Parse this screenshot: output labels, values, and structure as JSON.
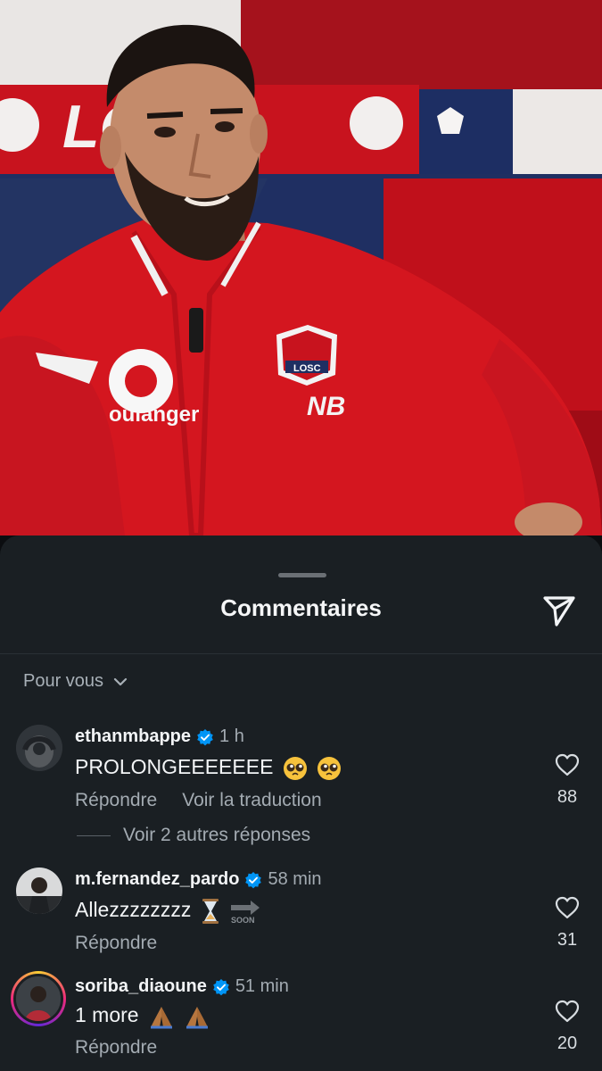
{
  "sheet": {
    "title": "Commentaires",
    "filter_label": "Pour vous"
  },
  "media": {
    "sponsor_text": "oulanger",
    "club_badge_text": "LOSC",
    "scarf_text": "LOSC"
  },
  "comments": [
    {
      "username": "ethanmbappe",
      "verified": true,
      "time": "1 h",
      "text": "PROLONGEEEEEEE",
      "emoji": [
        "pleading-face",
        "pleading-face"
      ],
      "reply_label": "Répondre",
      "translate_label": "Voir la traduction",
      "more_replies_label": "Voir 2 autres réponses",
      "likes": "88"
    },
    {
      "username": "m.fernandez_pardo",
      "verified": true,
      "time": "58 min",
      "text": "Allezzzzzzzz",
      "emoji": [
        "hourglass",
        "soon-arrow"
      ],
      "soon_label": "SOON",
      "reply_label": "Répondre",
      "likes": "31"
    },
    {
      "username": "soriba_diaoune",
      "verified": true,
      "time": "51 min",
      "text": "1 more",
      "emoji": [
        "folded-hands",
        "folded-hands"
      ],
      "reply_label": "Répondre",
      "likes": "20"
    }
  ],
  "colors": {
    "sheet_bg": "#1a1f23",
    "verified_blue": "#0095f6",
    "jacket_red": "#d4161f"
  }
}
